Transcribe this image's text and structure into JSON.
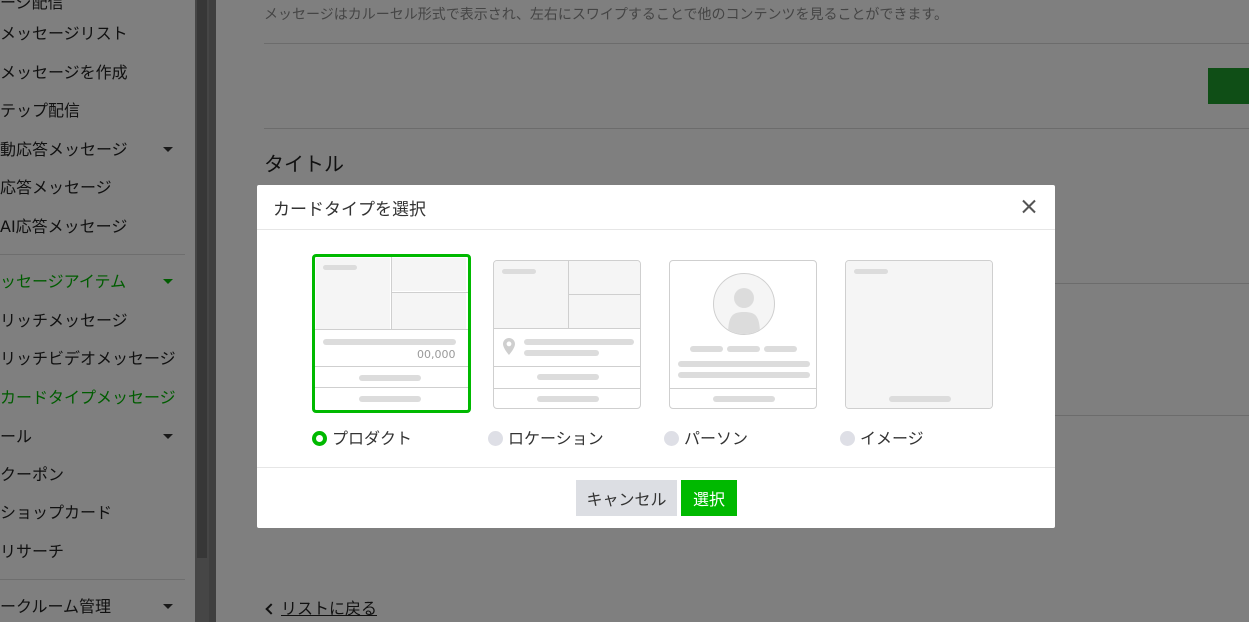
{
  "sidebar": {
    "items": [
      {
        "label": "ージ配信"
      },
      {
        "label": "メッセージリスト"
      },
      {
        "label": "メッセージを作成"
      },
      {
        "label": "テップ配信"
      },
      {
        "label": "動応答メッセージ"
      },
      {
        "label": "応答メッセージ"
      },
      {
        "label": "AI応答メッセージ"
      },
      {
        "label": "ッセージアイテム"
      },
      {
        "label": "リッチメッセージ"
      },
      {
        "label": "リッチビデオメッセージ"
      },
      {
        "label": "カードタイプメッセージ"
      },
      {
        "label": "ール"
      },
      {
        "label": "クーポン"
      },
      {
        "label": "ショップカード"
      },
      {
        "label": "リサーチ"
      },
      {
        "label": "ークルーム管理"
      }
    ]
  },
  "main": {
    "description": "メッセージはカルーセル形式で表示され、左右にスワイプすることで他のコンテンツを見ることができます。",
    "title": "タイトル",
    "back_link": "リストに戻る"
  },
  "modal": {
    "title": "カードタイプを選択",
    "card_types": [
      {
        "label": "プロダクト",
        "selected": true,
        "price_text": "00,000"
      },
      {
        "label": "ロケーション",
        "selected": false
      },
      {
        "label": "パーソン",
        "selected": false
      },
      {
        "label": "イメージ",
        "selected": false
      }
    ],
    "cancel_label": "キャンセル",
    "select_label": "選択"
  },
  "colors": {
    "accent": "#00b900",
    "overlay": "rgba(0,0,0,0.5)"
  }
}
